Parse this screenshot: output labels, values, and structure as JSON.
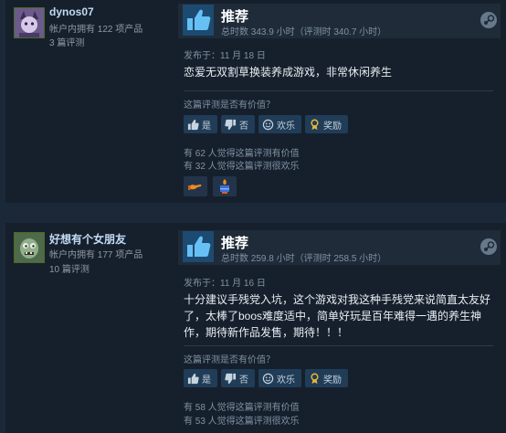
{
  "reviews": [
    {
      "username": "dynos07",
      "owned": "帐户内拥有 122 项产品",
      "review_count": "3 篇评测",
      "verdict": "推荐",
      "hours": "总时数 343.9 小时（评测时 340.7 小时）",
      "posted": "发布于：11 月 18 日",
      "body": "恋爱无双割草换装养成游戏，非常休闲养生",
      "helpful_question": "这篇评测是否有价值？",
      "buttons": {
        "yes": "是",
        "no": "否",
        "funny": "欢乐",
        "award": "奖励"
      },
      "helpful_stat": "有 62 人觉得这篇评测有价值",
      "funny_stat": "有 32 人觉得这篇评测很欢乐"
    },
    {
      "username": "好想有个女朋友",
      "owned": "帐户内拥有 177 项产品",
      "review_count": "10 篇评测",
      "verdict": "推荐",
      "hours": "总时数 259.8 小时（评测时 258.5 小时）",
      "posted": "发布于：11 月 16 日",
      "body": "十分建议手残党入坑，这个游戏对我这种手残党来说简直太友好了，太棒了boos难度适中，简单好玩是百年难得一遇的养生神作，期待新作品发售，期待！！！",
      "helpful_question": "这篇评测是否有价值？",
      "buttons": {
        "yes": "是",
        "no": "否",
        "funny": "欢乐",
        "award": "奖励"
      },
      "helpful_stat": "有 58 人觉得这篇评测有价值",
      "funny_stat": "有 53 人觉得这篇评测很欢乐"
    }
  ],
  "icons": {
    "thumbs_up": "thumbs-up-icon",
    "thumbs_down": "thumbs-down-icon",
    "funny": "smiley-icon",
    "award": "award-icon",
    "steam": "steam-icon"
  },
  "colors": {
    "background": "#1b2838",
    "card": "#16202d",
    "username": "#c1dbf4",
    "button": "#203c57",
    "thumb_box": "#1d4a70",
    "award_gold": "#e8b63a"
  }
}
